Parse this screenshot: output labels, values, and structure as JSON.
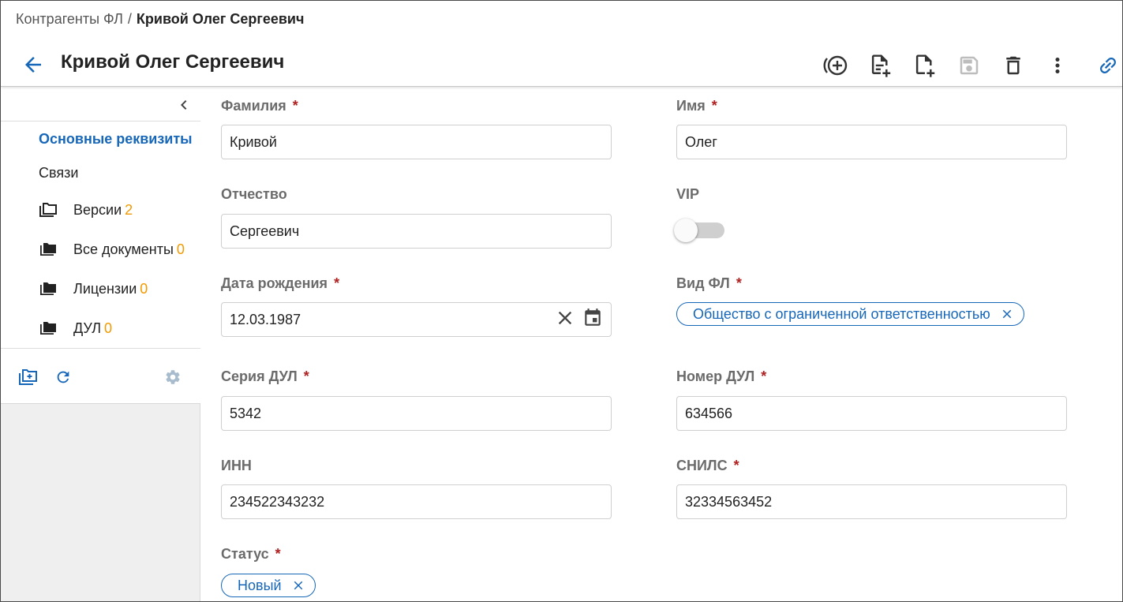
{
  "breadcrumb": {
    "parent": "Контрагенты ФЛ",
    "separator": "/",
    "current": "Кривой Олег Сергеевич"
  },
  "header": {
    "title": "Кривой Олег Сергеевич"
  },
  "sidebar": {
    "nav": [
      {
        "label": "Основные реквизиты",
        "active": true
      },
      {
        "label": "Связи",
        "active": false
      }
    ],
    "folders": [
      {
        "label": "Версии",
        "count": "2"
      },
      {
        "label": "Все документы",
        "count": "0"
      },
      {
        "label": "Лицензии",
        "count": "0"
      },
      {
        "label": "ДУЛ",
        "count": "0"
      }
    ]
  },
  "form": {
    "surname": {
      "label": "Фамилия",
      "required": "*",
      "value": "Кривой"
    },
    "name": {
      "label": "Имя",
      "required": "*",
      "value": "Олег"
    },
    "patronymic": {
      "label": "Отчество",
      "value": "Сергеевич"
    },
    "vip": {
      "label": "VIP",
      "on": false
    },
    "birth_date": {
      "label": "Дата рождения",
      "required": "*",
      "value": "12.03.1987"
    },
    "person_type": {
      "label": "Вид ФЛ",
      "required": "*",
      "chip": "Общество с ограниченной ответственностью"
    },
    "doc_series": {
      "label": "Серия ДУЛ",
      "required": "*",
      "value": "5342"
    },
    "doc_number": {
      "label": "Номер ДУЛ",
      "required": "*",
      "value": "634566"
    },
    "inn": {
      "label": "ИНН",
      "value": "234522343232"
    },
    "snils": {
      "label": "СНИЛС",
      "required": "*",
      "value": "32334563452"
    },
    "status": {
      "label": "Статус",
      "required": "*",
      "chip": "Новый"
    }
  },
  "colors": {
    "accent": "#1767b9",
    "count": "#f29a00",
    "required": "#b02020",
    "label": "#6b6b6b"
  },
  "icons": {
    "back": "arrow-left-icon",
    "toolbar": [
      "add-circle-icon",
      "add-document-icon",
      "add-file-icon",
      "save-icon",
      "delete-icon",
      "more-vert-icon",
      "link-icon"
    ],
    "sidebar_tools": [
      "add-folder-icon",
      "refresh-icon",
      "settings-icon"
    ]
  }
}
